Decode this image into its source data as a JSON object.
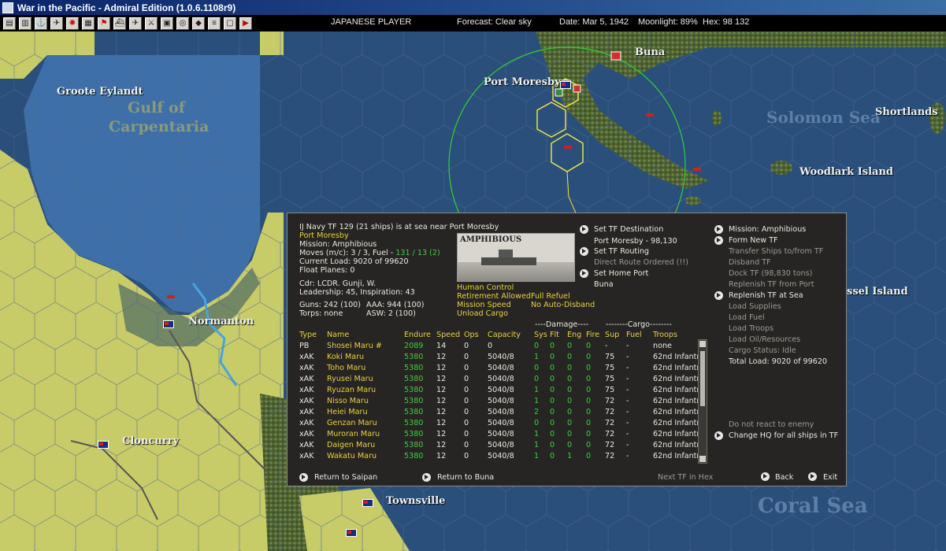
{
  "window": {
    "title": "War in the Pacific - Admiral Edition (1.0.6.1108r9)"
  },
  "toolbar": {
    "icons": [
      "map-icon",
      "report-icon",
      "ships-icon",
      "air-icon",
      "japan-flag-icon",
      "bases-icon",
      "flag-icon",
      "fleet-icon",
      "plane-icon",
      "ground-icon",
      "supply-icon",
      "intel-icon",
      "op-icon",
      "list-icon",
      "settings-icon",
      "end-turn-icon"
    ],
    "player": "JAPANESE PLAYER",
    "forecast": "Forecast: Clear sky",
    "date": "Date: Mar 5, 1942",
    "moonlight": "Moonlight: 89%",
    "hex": "Hex: 98 132"
  },
  "map": {
    "labels": {
      "groote": "Groote Eylandt",
      "gulf": "Gulf of",
      "carpentaria": "Carpentaria",
      "port_moresby": "Port Moresby",
      "buna": "Buna",
      "solomon": "Solomon Sea",
      "shortlands": "Shortlands",
      "woodlark": "Woodlark Island",
      "rossel": "ssel Island",
      "normanton": "Normanton",
      "cloncurry": "Cloncurry",
      "townsville": "Townsville",
      "coral": "Coral Sea"
    },
    "colors": {
      "sea": "#2a4f7a",
      "shallow": "#3e6fa8",
      "land": "#c8cc68",
      "jungle": "#5a6b3a",
      "hexline": "#4e6a94",
      "range": "#2fd32f",
      "path": "#f0e040"
    }
  },
  "dialog": {
    "header": "IJ Navy TF 129 (21 ships) is at sea near Port Moresby",
    "location": "Port Moresby",
    "mission": "Mission: Amphibious",
    "moves_prefix": "Moves (m/c): 3 / 3, Fuel - ",
    "moves_fuel": "131 / 13 (2)",
    "load": "Current Load: 9020 of 99620",
    "float": "Float Planes: 0",
    "cdr": "Cdr: LCDR. Gunji, W.",
    "leadership": "Leadership: 45, Inspiration: 43",
    "guns": "Guns: 242 (100)",
    "aaa": "AAA: 944 (100)",
    "torps": "Torps: none",
    "asw": "ASW: 2 (100)",
    "photo_caption": "AMPHIBIOUS",
    "settings": {
      "human_control": "Human Control",
      "retirement": "Retirement Allowed",
      "full_refuel": "Full Refuel",
      "mission_speed": "Mission Speed",
      "no_auto": "No Auto-Disband",
      "unload": "Unload Cargo"
    },
    "mid": {
      "set_dest": "Set TF Destination",
      "dest_val": "Port Moresby - 98,130",
      "set_routing": "Set TF Routing",
      "direct": "Direct Route Ordered (!!)",
      "set_home": "Set Home Port",
      "home_val": "Buna"
    },
    "right": {
      "mission": "Mission: Amphibious",
      "form_new": "Form New TF",
      "transfer": "Transfer Ships to/from TF",
      "disband": "Disband TF",
      "dock": "Dock TF (98,830 tons)",
      "replenish_port": "Replenish TF from Port",
      "replenish_sea": "Replenish TF at Sea",
      "load_supplies": "Load Supplies",
      "load_fuel": "Load Fuel",
      "load_troops": "Load Troops",
      "load_oil": "Load Oil/Resources",
      "cargo_status": "Cargo Status: Idle",
      "total_load": "Total Load: 9020 of 99620",
      "no_react": "Do not react to enemy",
      "change_hq": "Change HQ for all ships in TF"
    },
    "group_headers": {
      "damage": "----Damage----",
      "cargo": "--------Cargo--------"
    },
    "columns": [
      "Type",
      "Name",
      "Endure",
      "Speed",
      "Ops",
      "Capacity",
      "Sys",
      "Flt",
      "Eng",
      "Fire",
      "Sup",
      "Fuel",
      "Troops"
    ],
    "rows": [
      [
        "PB",
        "Shosei Maru #",
        "2089",
        "14",
        "0",
        "0",
        "0",
        "0",
        "0",
        "0",
        "-",
        "-",
        "none"
      ],
      [
        "xAK",
        "Koki Maru",
        "5380",
        "12",
        "0",
        "5040/8",
        "1",
        "0",
        "0",
        "0",
        "75",
        "-",
        "62nd Infantr"
      ],
      [
        "xAK",
        "Toho Maru",
        "5380",
        "12",
        "0",
        "5040/8",
        "0",
        "0",
        "0",
        "0",
        "75",
        "-",
        "62nd Infantr"
      ],
      [
        "xAK",
        "Ryusei Maru",
        "5380",
        "12",
        "0",
        "5040/8",
        "0",
        "0",
        "0",
        "0",
        "75",
        "-",
        "62nd Infantr"
      ],
      [
        "xAK",
        "Ryuzan Maru",
        "5380",
        "12",
        "0",
        "5040/8",
        "1",
        "0",
        "0",
        "0",
        "75",
        "-",
        "62nd Infantr"
      ],
      [
        "xAK",
        "Nisso Maru",
        "5380",
        "12",
        "0",
        "5040/8",
        "1",
        "0",
        "0",
        "0",
        "72",
        "-",
        "62nd Infantr"
      ],
      [
        "xAK",
        "Heiei Maru",
        "5380",
        "12",
        "0",
        "5040/8",
        "2",
        "0",
        "0",
        "0",
        "72",
        "-",
        "62nd Infantr"
      ],
      [
        "xAK",
        "Genzan Maru",
        "5380",
        "12",
        "0",
        "5040/8",
        "0",
        "0",
        "0",
        "0",
        "72",
        "-",
        "62nd Infantr"
      ],
      [
        "xAK",
        "Muroran Maru",
        "5380",
        "12",
        "0",
        "5040/8",
        "1",
        "0",
        "0",
        "0",
        "72",
        "-",
        "62nd Infantr"
      ],
      [
        "xAK",
        "Daigen Maru",
        "5380",
        "12",
        "0",
        "5040/8",
        "1",
        "0",
        "0",
        "0",
        "72",
        "-",
        "62nd Infantr"
      ],
      [
        "xAK",
        "Wakatu Maru",
        "5380",
        "12",
        "0",
        "5040/8",
        "1",
        "0",
        "1",
        "0",
        "72",
        "-",
        "62nd Infantr"
      ]
    ],
    "bottom": {
      "return_saipan": "Return to Saipan",
      "return_buna": "Return to Buna",
      "next_tf": "Next TF in Hex",
      "back": "Back",
      "exit": "Exit"
    }
  }
}
